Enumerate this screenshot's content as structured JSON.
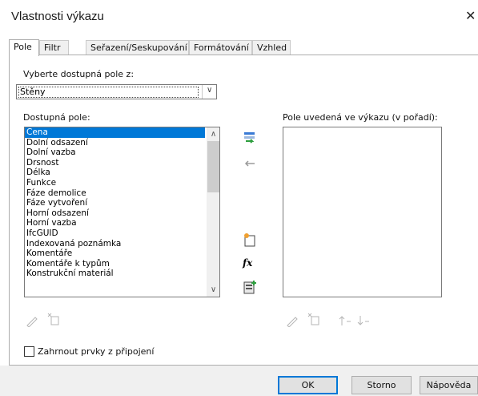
{
  "window": {
    "title": "Vlastnosti výkazu",
    "close_glyph": "✕"
  },
  "tabs": [
    {
      "label": "Pole",
      "active": true
    },
    {
      "label": "Filtr"
    },
    {
      "label": "Seřazení/Seskupování"
    },
    {
      "label": "Formátování"
    },
    {
      "label": "Vzhled"
    }
  ],
  "source": {
    "label": "Vyberte dostupná pole z:",
    "selected": "Stěny"
  },
  "available": {
    "label": "Dostupná pole:",
    "items": [
      "Cena",
      "Dolní odsazení",
      "Dolní vazba",
      "Drsnost",
      "Délka",
      "Funkce",
      "Fáze demolice",
      "Fáze vytvoření",
      "Horní odsazení",
      "Horní vazba",
      "IfcGUID",
      "Indexovaná poznámka",
      "Komentáře",
      "Komentáře k typům",
      "Konstrukční materiál"
    ],
    "selected_index": 0
  },
  "scheduled": {
    "label": "Pole uvedená ve výkazu (v pořadí):",
    "items": []
  },
  "icons": {
    "add": "add-field-icon",
    "remove": "remove-field-icon",
    "new_parameter": "new-parameter-icon",
    "calculated": "calculated-value-icon",
    "combine": "combine-parameters-icon",
    "formula_glyph": "fx"
  },
  "include_linked": {
    "label": "Zahrnout prvky z připojení",
    "checked": false
  },
  "buttons": {
    "ok": "OK",
    "cancel": "Storno",
    "help": "Nápověda"
  },
  "colors": {
    "selection": "#0078d7",
    "default_button_border": "#0078d7"
  }
}
